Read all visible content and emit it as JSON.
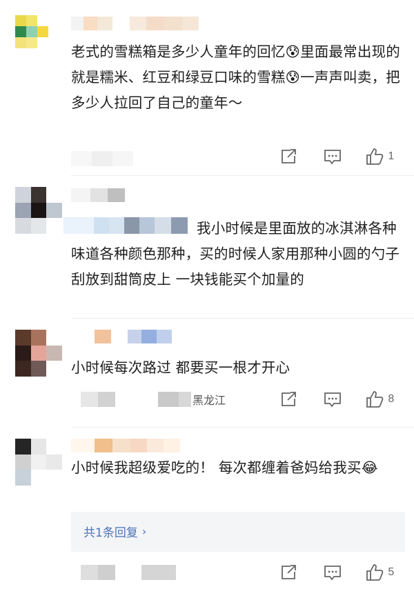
{
  "comments": [
    {
      "text": "老式的雪糕箱是多少人童年的回忆😰里面最常出现的就是糯米、红豆和绿豆口味的雪糕😰一声声叫卖，把多少人拉回了自己的童年～",
      "likes": "1",
      "location": ""
    },
    {
      "text": "我小时候是里面放的冰淇淋各种味道各种颜色那种，买的时候人家用那种小圆的勺子刮放到甜筒皮上 一块钱能买个加量的",
      "likes": "",
      "location": ""
    },
    {
      "text": "小时候每次路过 都要买一根才开心",
      "likes": "8",
      "location": "黑龙江"
    },
    {
      "text": "小时候我超级爱吃的！ 每次都缠着爸妈给我买😂",
      "likes": "5",
      "location": "",
      "replies_label": "共1条回复",
      "replies_chevron": "›"
    }
  ],
  "icons": {
    "share": "share-icon",
    "reply": "comment-icon",
    "like": "thumbs-up-icon"
  },
  "colors": {
    "link": "#4a73b5",
    "text": "#1f1f1f",
    "icon": "#666666"
  }
}
